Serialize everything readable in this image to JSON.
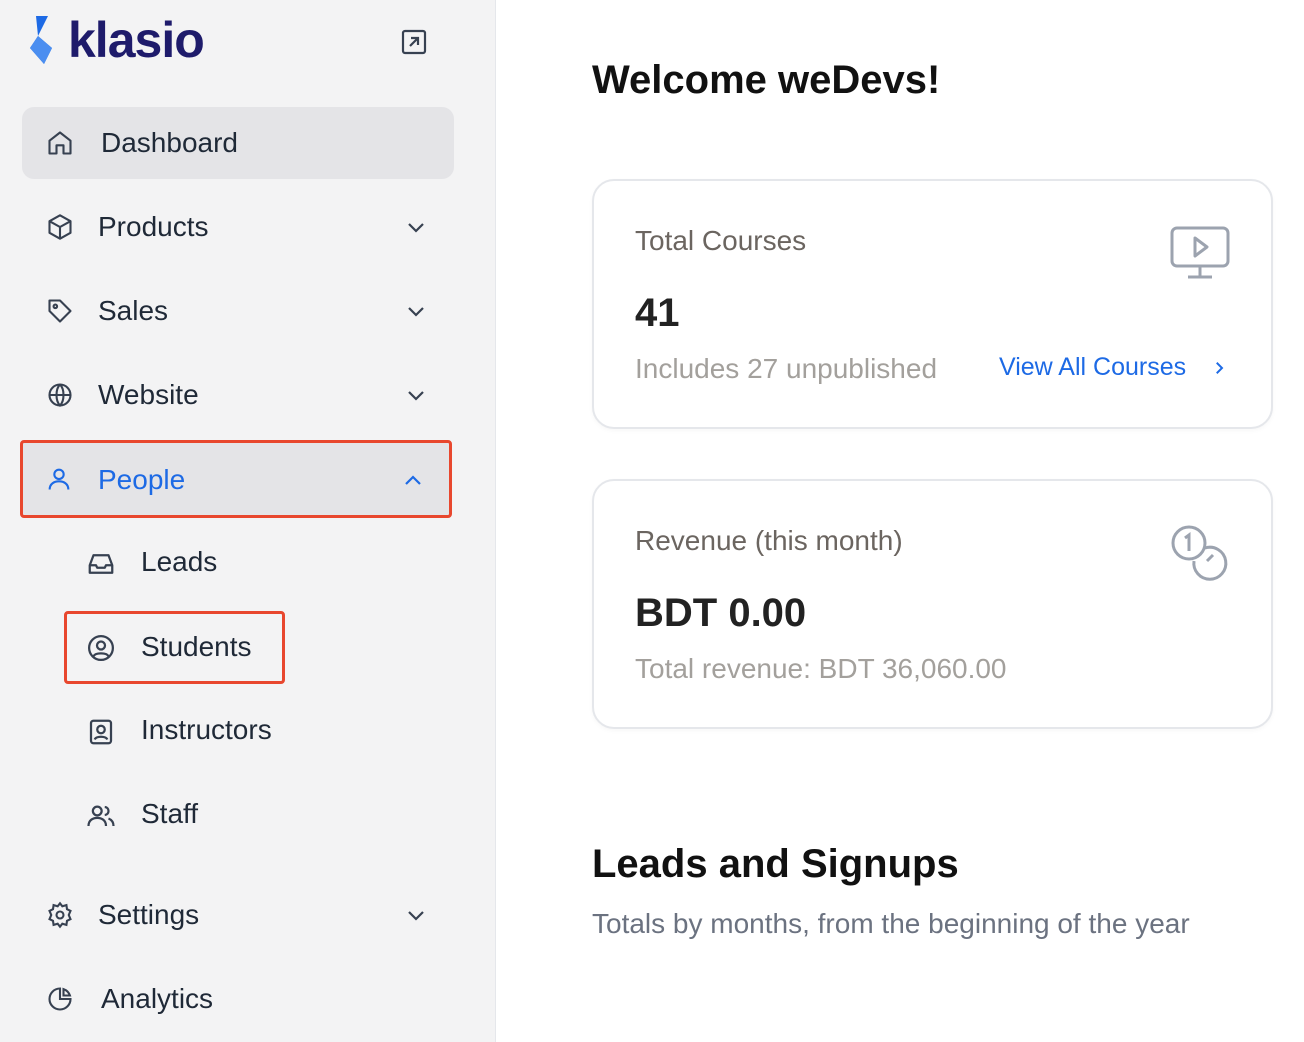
{
  "brand": {
    "name": "klasio",
    "logo_color": "#1d6ae5",
    "text_color": "#1e1b6b"
  },
  "sidebar": {
    "items": [
      {
        "label": "Dashboard",
        "icon": "home-icon"
      },
      {
        "label": "Products",
        "icon": "box-icon"
      },
      {
        "label": "Sales",
        "icon": "tag-icon"
      },
      {
        "label": "Website",
        "icon": "globe-icon"
      },
      {
        "label": "People",
        "icon": "user-icon"
      },
      {
        "label": "Settings",
        "icon": "gear-icon"
      },
      {
        "label": "Analytics",
        "icon": "pie-chart-icon"
      }
    ],
    "people_sub": [
      {
        "label": "Leads",
        "icon": "inbox-icon"
      },
      {
        "label": "Students",
        "icon": "user-circle-icon"
      },
      {
        "label": "Instructors",
        "icon": "id-badge-icon"
      },
      {
        "label": "Staff",
        "icon": "users-icon"
      }
    ],
    "active_item": "Dashboard",
    "expanded_item": "People",
    "highlight_color": "#e8472e"
  },
  "main": {
    "welcome": "Welcome weDevs!",
    "cards": [
      {
        "title": "Total Courses",
        "value": "41",
        "subtitle": "Includes 27 unpublished",
        "link": "View All Courses",
        "icon": "monitor-play-icon"
      },
      {
        "title": "Revenue (this month)",
        "value": "BDT 0.00",
        "subtitle": "Total revenue: BDT 36,060.00",
        "icon": "coins-icon"
      }
    ],
    "section": {
      "title": "Leads and Signups",
      "subtitle": "Totals by months, from the beginning of the year"
    }
  },
  "colors": {
    "accent": "#1d6ae5",
    "highlight": "#e8472e",
    "sidebar_bg": "#f3f3f4"
  }
}
